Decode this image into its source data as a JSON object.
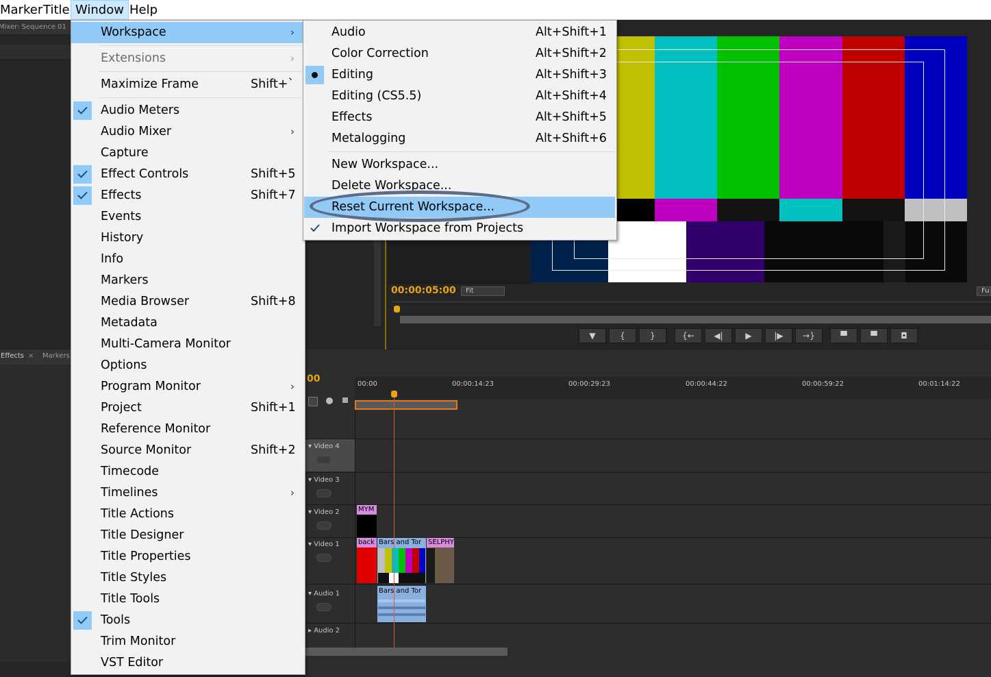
{
  "menubar": {
    "items": [
      {
        "label": "Marker"
      },
      {
        "label": "Title"
      },
      {
        "label": "Window"
      },
      {
        "label": "Help"
      }
    ]
  },
  "background": {
    "audio_mixer_tab": "Mixer: Sequence 01",
    "effects_tab": "Effects",
    "markers_tab": "Markers",
    "program_timecode": "00:00:05:00",
    "fit_dropdown": "Fit",
    "full_dropdown": "Fu",
    "timeline_timecode": "00",
    "ruler_labels": [
      "00:00",
      "00:00:14:23",
      "00:00:29:23",
      "00:00:44:22",
      "00:00:59:22",
      "00:01:14:22"
    ],
    "tracks": [
      "Video 4",
      "Video 3",
      "Video 2",
      "Video 1",
      "Audio 1",
      "Audio 2"
    ],
    "clips": {
      "video2_clip": "MYM",
      "back_clip": "back",
      "bars_video_clip": "Bars and Tor",
      "selphy_clip": "SELPHY",
      "bars_audio_clip": "Bars and Tor"
    }
  },
  "window_menu": {
    "workspace": {
      "label": "Workspace"
    },
    "extensions": {
      "label": "Extensions"
    },
    "maximize_frame": {
      "label": "Maximize Frame",
      "shortcut": "Shift+`"
    },
    "audio_meters": {
      "label": "Audio Meters"
    },
    "audio_mixer": {
      "label": "Audio Mixer"
    },
    "capture": {
      "label": "Capture"
    },
    "effect_controls": {
      "label": "Effect Controls",
      "shortcut": "Shift+5"
    },
    "effects": {
      "label": "Effects",
      "shortcut": "Shift+7"
    },
    "events": {
      "label": "Events"
    },
    "history": {
      "label": "History"
    },
    "info": {
      "label": "Info"
    },
    "markers": {
      "label": "Markers"
    },
    "media_browser": {
      "label": "Media Browser",
      "shortcut": "Shift+8"
    },
    "metadata": {
      "label": "Metadata"
    },
    "multi_camera_monitor": {
      "label": "Multi-Camera Monitor"
    },
    "options": {
      "label": "Options"
    },
    "program_monitor": {
      "label": "Program Monitor"
    },
    "project": {
      "label": "Project",
      "shortcut": "Shift+1"
    },
    "reference_monitor": {
      "label": "Reference Monitor"
    },
    "source_monitor": {
      "label": "Source Monitor",
      "shortcut": "Shift+2"
    },
    "timecode": {
      "label": "Timecode"
    },
    "timelines": {
      "label": "Timelines"
    },
    "title_actions": {
      "label": "Title Actions"
    },
    "title_designer": {
      "label": "Title Designer"
    },
    "title_properties": {
      "label": "Title Properties"
    },
    "title_styles": {
      "label": "Title Styles"
    },
    "title_tools": {
      "label": "Title Tools"
    },
    "tools": {
      "label": "Tools"
    },
    "trim_monitor": {
      "label": "Trim Monitor"
    },
    "vst_editor": {
      "label": "VST Editor"
    }
  },
  "workspace_menu": {
    "audio": {
      "label": "Audio",
      "shortcut": "Alt+Shift+1"
    },
    "color_correction": {
      "label": "Color Correction",
      "shortcut": "Alt+Shift+2"
    },
    "editing": {
      "label": "Editing",
      "shortcut": "Alt+Shift+3"
    },
    "editing_cs55": {
      "label": "Editing (CS5.5)",
      "shortcut": "Alt+Shift+4"
    },
    "effects": {
      "label": "Effects",
      "shortcut": "Alt+Shift+5"
    },
    "metalogging": {
      "label": "Metalogging",
      "shortcut": "Alt+Shift+6"
    },
    "new_workspace": {
      "label": "New Workspace..."
    },
    "delete_workspace": {
      "label": "Delete Workspace..."
    },
    "reset_current_workspace": {
      "label": "Reset Current Workspace..."
    },
    "import_workspace": {
      "label": "Import Workspace from Projects"
    }
  },
  "colors": {
    "highlight": "#91c9f7",
    "menu_bg": "#f2f2f2",
    "timecode": "#e8a417",
    "playhead": "#d9534f",
    "annotation": "#5b6e85"
  }
}
